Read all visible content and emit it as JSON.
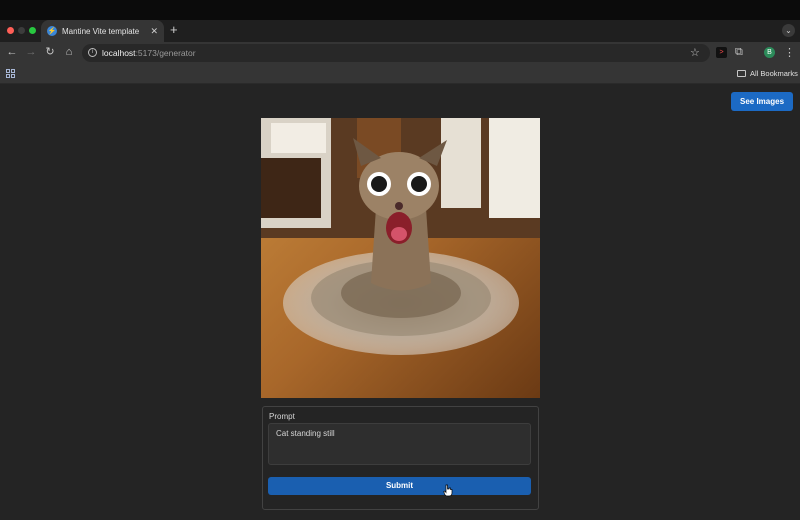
{
  "browser": {
    "tab_title": "Mantine Vite template",
    "url_host": "localhost",
    "url_path": ":5173/generator",
    "profile_initial": "B",
    "bookmarks_label": "All Bookmarks",
    "icons": {
      "back": "back-arrow-icon",
      "forward": "forward-arrow-icon",
      "reload": "reload-icon",
      "home": "home-icon",
      "star": "star-icon"
    }
  },
  "header": {
    "see_images_label": "See Images",
    "accent_color": "#1c6ac4"
  },
  "generator": {
    "prompt_label": "Prompt",
    "prompt_value": "Cat standing still",
    "submit_label": "Submit"
  }
}
